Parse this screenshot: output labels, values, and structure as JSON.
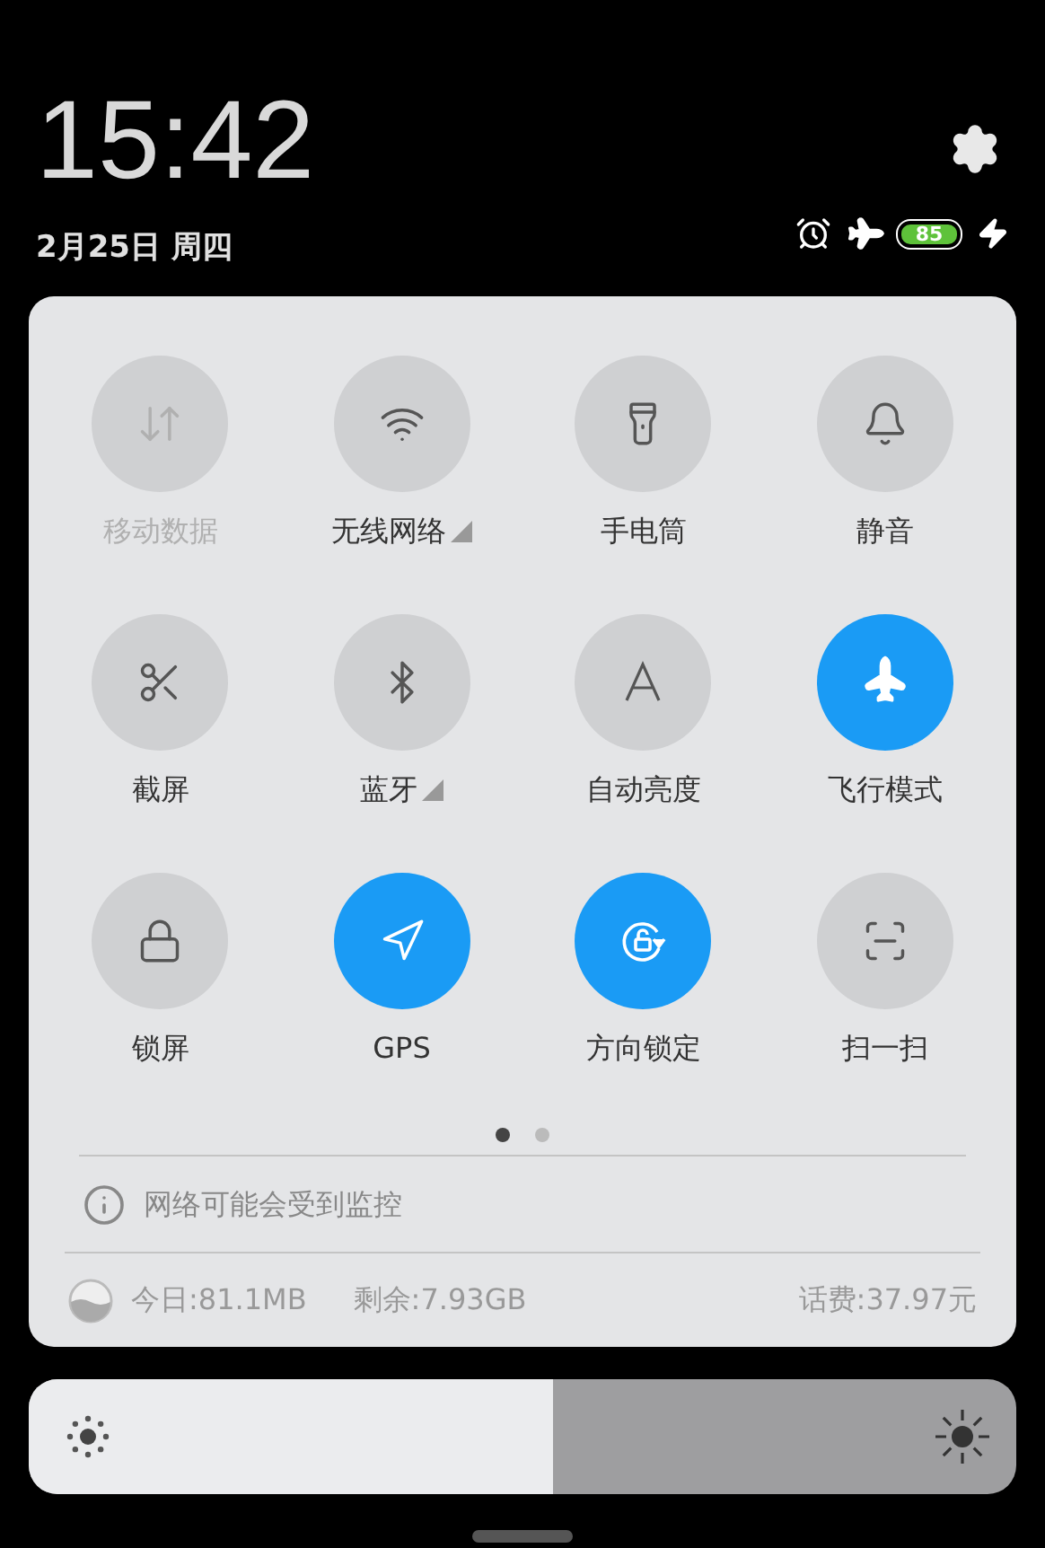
{
  "status": {
    "time": "15:42",
    "date": "2月25日 周四",
    "battery": "85",
    "alarm": true,
    "airplane": true,
    "charging": true
  },
  "tiles": [
    {
      "kind": "mobile-data",
      "label": "移动数据",
      "on": false,
      "disabled": true,
      "has_menu": false
    },
    {
      "kind": "wifi",
      "label": "无线网络",
      "on": false,
      "disabled": false,
      "has_menu": true
    },
    {
      "kind": "flashlight",
      "label": "手电筒",
      "on": false,
      "disabled": false,
      "has_menu": false
    },
    {
      "kind": "silent",
      "label": "静音",
      "on": false,
      "disabled": false,
      "has_menu": false
    },
    {
      "kind": "screenshot",
      "label": "截屏",
      "on": false,
      "disabled": false,
      "has_menu": false
    },
    {
      "kind": "bluetooth",
      "label": "蓝牙",
      "on": false,
      "disabled": false,
      "has_menu": true
    },
    {
      "kind": "auto-brightness",
      "label": "自动亮度",
      "on": false,
      "disabled": false,
      "has_menu": false
    },
    {
      "kind": "airplane",
      "label": "飞行模式",
      "on": true,
      "disabled": false,
      "has_menu": false
    },
    {
      "kind": "lock",
      "label": "锁屏",
      "on": false,
      "disabled": false,
      "has_menu": false
    },
    {
      "kind": "gps",
      "label": "GPS",
      "on": true,
      "disabled": false,
      "has_menu": false
    },
    {
      "kind": "rotation-lock",
      "label": "方向锁定",
      "on": true,
      "disabled": false,
      "has_menu": false
    },
    {
      "kind": "scan",
      "label": "扫一扫",
      "on": false,
      "disabled": false,
      "has_menu": false
    }
  ],
  "pages": [
    {
      "selected": true
    },
    {
      "selected": false
    }
  ],
  "notice": "网络可能会受到监控",
  "usage": {
    "today": "今日:81.1MB",
    "remaining": "剩余:7.93GB",
    "balance": "话费:37.97元"
  },
  "brightness": {
    "level": 0.53
  }
}
